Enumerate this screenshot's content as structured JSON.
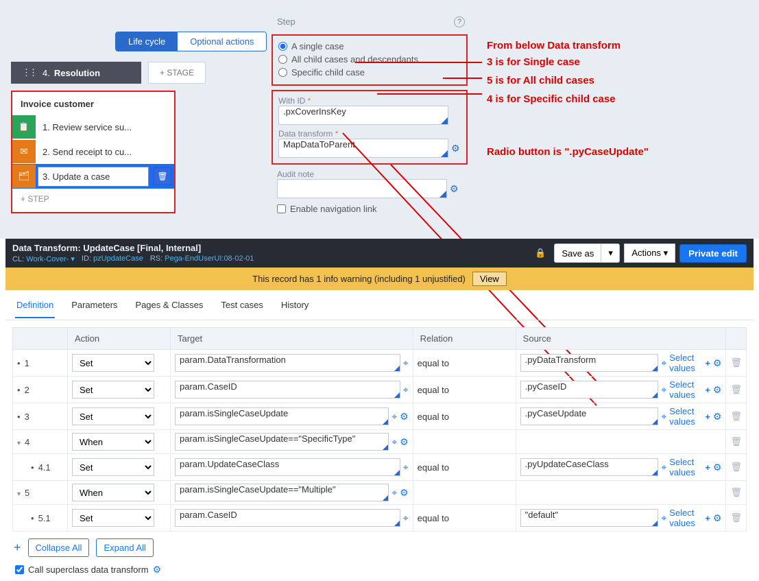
{
  "tabs": {
    "lifecycle": "Life cycle",
    "optional": "Optional actions"
  },
  "stage": {
    "num": "4.",
    "name": "Resolution",
    "add": "+ STAGE"
  },
  "process": {
    "title": "Invoice customer",
    "steps": [
      {
        "n": "1.",
        "t": "Review service su..."
      },
      {
        "n": "2.",
        "t": "Send receipt to cu..."
      },
      {
        "n": "3.",
        "t": "Update a case"
      }
    ],
    "addStep": "+ STEP"
  },
  "prop": {
    "title": "Step",
    "radio": {
      "single": "A single case",
      "all": "All child cases and descendants",
      "specific": "Specific child case"
    },
    "withId": {
      "label": "With ID",
      "value": ".pxCoverInsKey"
    },
    "dt": {
      "label": "Data transform",
      "value": "MapDataToParent"
    },
    "audit": {
      "label": "Audit note",
      "value": ""
    },
    "enableNav": "Enable navigation link"
  },
  "anno": {
    "a1": "From below Data transform",
    "a2": "3 is for Single case",
    "a3": "5 is for All child cases",
    "a4": "4 is for Specific child case",
    "a5": "Radio button is \".pyCaseUpdate\""
  },
  "rule": {
    "title": "Data Transform: UpdateCase [Final, Internal]",
    "cl_l": "CL:",
    "cl_v": "Work-Cover-",
    "id_l": "ID:",
    "id_v": "pzUpdateCase",
    "rs_l": "RS:",
    "rs_v": "Pega-EndUserUI:08-02-01",
    "saveAs": "Save as",
    "actions": "Actions",
    "priv": "Private edit",
    "warn": "This record has 1 info warning (including 1 unjustified)",
    "view": "View",
    "tabs": [
      "Definition",
      "Parameters",
      "Pages & Classes",
      "Test cases",
      "History"
    ]
  },
  "grid": {
    "headers": {
      "a": "Action",
      "t": "Target",
      "r": "Relation",
      "s": "Source"
    },
    "rows": [
      {
        "idx": "1",
        "kind": "bullet",
        "action": "Set",
        "target": "param.DataTransformation",
        "relation": "equal to",
        "source": ".pyDataTransform",
        "sv": true
      },
      {
        "idx": "2",
        "kind": "bullet",
        "action": "Set",
        "target": "param.CaseID",
        "relation": "equal to",
        "source": ".pyCaseID",
        "sv": true
      },
      {
        "idx": "3",
        "kind": "bullet",
        "action": "Set",
        "target": "param.isSingleCaseUpdate",
        "relation": "equal to",
        "source": ".pyCaseUpdate",
        "sv": true,
        "gearsExtra": true
      },
      {
        "idx": "4",
        "kind": "chev",
        "action": "When",
        "target": "param.isSingleCaseUpdate==\"SpecificType\"",
        "relation": "",
        "source": "",
        "sv": false,
        "gearsExtra": true
      },
      {
        "idx": "4.1",
        "kind": "sub",
        "action": "Set",
        "target": "param.UpdateCaseClass",
        "relation": "equal to",
        "source": ".pyUpdateCaseClass",
        "sv": true
      },
      {
        "idx": "5",
        "kind": "chev",
        "action": "When",
        "target": "param.isSingleCaseUpdate==\"Multiple\"",
        "relation": "",
        "source": "",
        "sv": false,
        "gearsExtra": true
      },
      {
        "idx": "5.1",
        "kind": "sub",
        "action": "Set",
        "target": "param.CaseID",
        "relation": "equal to",
        "source": "\"default\"",
        "sv": true
      }
    ],
    "selectValues": "Select values",
    "collapse": "Collapse All",
    "expand": "Expand All",
    "superclass": "Call superclass data transform"
  }
}
